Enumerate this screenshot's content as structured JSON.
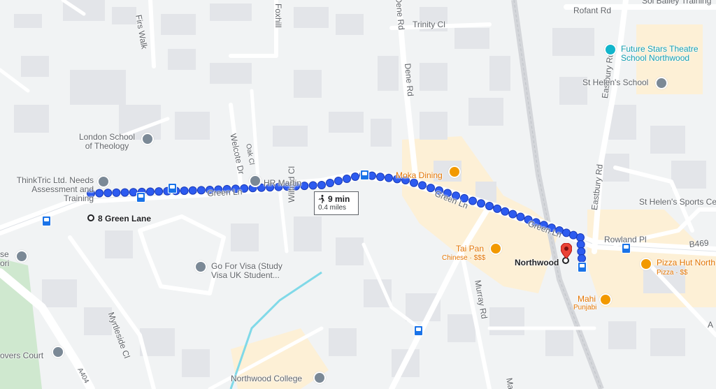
{
  "colors": {
    "route": "#2d5bf0",
    "route_outline": "#1a3ab8",
    "road": "#ffffff",
    "road_main": "#ffffff",
    "block": "#e3e5e9",
    "land": "#f1f3f4",
    "water": "#80d9e8",
    "park": "#cfe8cf",
    "commercial": "#fdf0d6"
  },
  "route": {
    "duration": "9 min",
    "distance": "0.4 miles",
    "mode_icon": "walking-icon"
  },
  "start": {
    "label": "8 Green Lane"
  },
  "destination": {
    "label": "Northwood"
  },
  "roads": {
    "firs_walk": "Firs Walk",
    "foxhill": "Foxhill",
    "dene_rd_top": "Dene Rd",
    "dene_rd": "Dene Rd",
    "trinity_cl": "Trinity Cl",
    "rofant_rd": "Rofant Rd",
    "eastbury_rd": "Eastbury Rd",
    "welcote_dr": "Welcote Dr",
    "oak_cl": "Oak Cl",
    "green_ln_1": "Green Ln",
    "green_ln_2": "Green Ln",
    "green_ln_3": "Green Ln",
    "rowland_pl": "Rowland Pl",
    "b469": "B469",
    "wilford_cl": "Wilford Cl",
    "murray_rd": "Murray Rd",
    "myrtleside_cl": "Myrtleside Cl",
    "a404": "A404",
    "ma": "Ma",
    "a": "A",
    "sol_bailey": "Sol Bailey Training"
  },
  "places": {
    "future_stars": "Future Stars Theatre School Northwood",
    "st_helens_school": "St Helen's School",
    "london_school": "London School of Theology",
    "hr_martin": "HR Martin",
    "thinktric": "ThinkTric Ltd. Needs Assessment and Training",
    "moka_dining": "Moka Dining",
    "st_helens_sports": "St Helen's Sports Ce",
    "tai_pan": "Tai Pan",
    "tai_pan_sub": "Chinese · $$$",
    "pizza_hut": "Pizza Hut North",
    "pizza_hut_sub": "Pizza · $$",
    "mahi": "Mahi",
    "mahi_sub": "Punjabi",
    "go_for_visa": "Go For Visa (Study Visa UK Student...",
    "ose_ori": "se ori",
    "overs_court": "overs Court",
    "northwood_college": "Northwood College"
  }
}
